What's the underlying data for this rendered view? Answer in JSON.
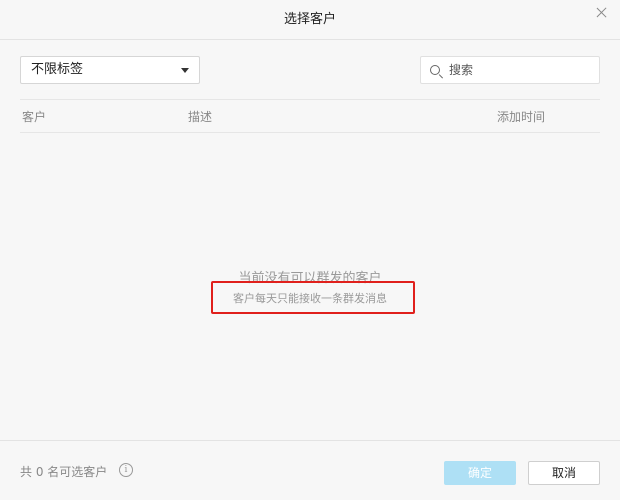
{
  "dialog": {
    "title": "选择客户"
  },
  "filter": {
    "tag_select_value": "不限标签",
    "search_placeholder": "搜索"
  },
  "table": {
    "columns": [
      "客户",
      "描述",
      "添加时间"
    ]
  },
  "empty_state": {
    "title": "当前没有可以群发的客户",
    "subtitle": "客户每天只能接收一条群发消息"
  },
  "footer": {
    "count_text": "共 0 名可选客户",
    "info_icon_glyph": "i",
    "confirm_label": "确定",
    "cancel_label": "取消"
  },
  "colors": {
    "highlight_border": "#e0201c",
    "confirm_disabled_bg": "#aee0f5"
  },
  "icons": [
    "close-icon",
    "chevron-down-icon",
    "search-icon",
    "info-icon"
  ]
}
